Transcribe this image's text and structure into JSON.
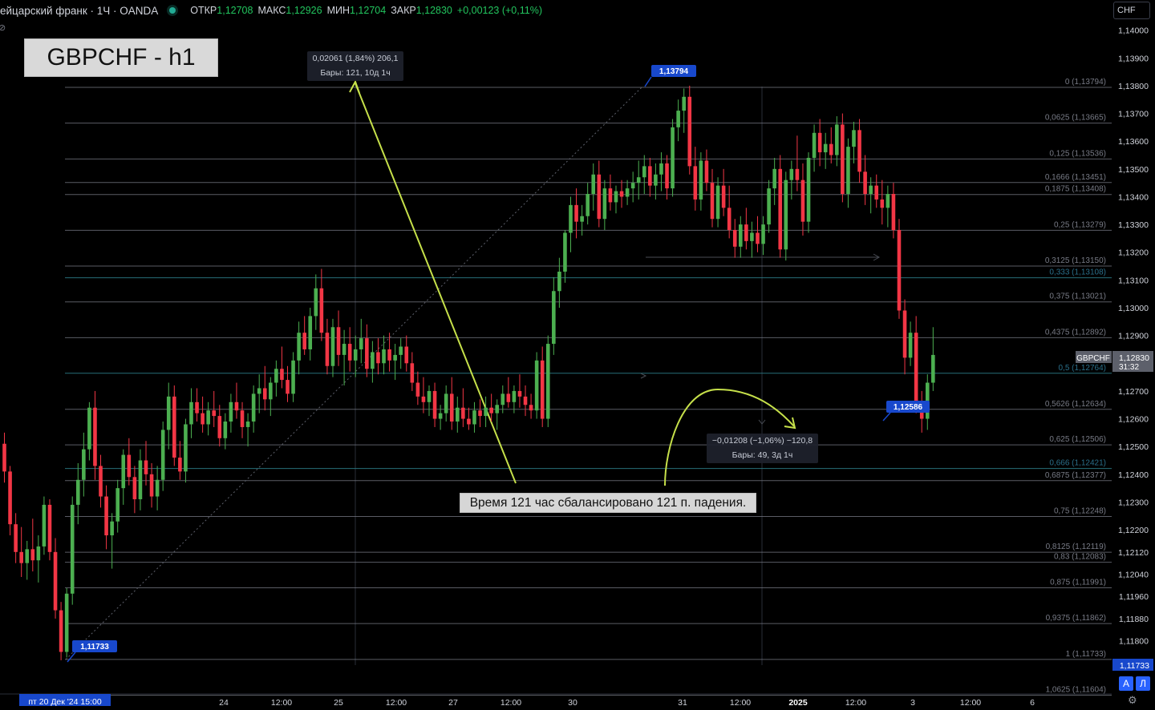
{
  "header": {
    "symbol": "ейцарский франк · 1Ч · OANDA",
    "open_label": "ОТКР",
    "open": "1,12708",
    "high_label": "МАКС",
    "high": "1,12926",
    "low_label": "МИН",
    "low": "1,12704",
    "close_label": "ЗАКР",
    "close": "1,12830",
    "change": "+0,00123 (+0,11%)"
  },
  "title_box": "GBPCHF - h1",
  "currency_button": "CHF",
  "scale_buttons": {
    "auto": "А",
    "log": "Л"
  },
  "annotation_note": "Время 121 час сбалансировано 121 п. падения.",
  "measure_up": {
    "line1": "0,02061 (1,84%) 206,1",
    "line2": "Бары: 121, 10д 1ч"
  },
  "measure_down": {
    "line1": "−0,01208 (−1,06%) −120,8",
    "line2": "Бары: 49, 3д 1ч"
  },
  "colors": {
    "background": "#000000",
    "up": "#26a69a",
    "up_candle": "#4caf50",
    "down_candle": "#f23645",
    "fib_line": "#787b86",
    "teal_line": "#2b7a85",
    "arrow": "#c6e04a",
    "label_blue": "#1848cc"
  },
  "chart_data": {
    "type": "candlestick",
    "timeframe": "1Ч",
    "y_range": [
      1.11733,
      1.1414
    ],
    "price_axis_ticks": [
      "1,14000",
      "1,13900",
      "1,13800",
      "1,13700",
      "1,13600",
      "1,13500",
      "1,13400",
      "1,13300",
      "1,13200",
      "1,13100",
      "1,13000",
      "1,12900",
      "1,12700",
      "1,12600",
      "1,12500",
      "1,12400",
      "1,12300",
      "1,12200",
      "1,12120",
      "1,12040",
      "1,11960",
      "1,11880",
      "1,11800"
    ],
    "time_axis_ticks": [
      "пт 20 Дек '24  15:00",
      "24",
      "12:00",
      "25",
      "12:00",
      "27",
      "12:00",
      "30",
      "31",
      "12:00",
      "2025",
      "12:00",
      "3",
      "12:00",
      "6"
    ],
    "fibonacci_levels": [
      {
        "ratio": "0",
        "price": "1,13794"
      },
      {
        "ratio": "0,0625",
        "price": "1,13665"
      },
      {
        "ratio": "0,125",
        "price": "1,13536"
      },
      {
        "ratio": "0,1666",
        "price": "1,13451"
      },
      {
        "ratio": "0,1875",
        "price": "1,13408"
      },
      {
        "ratio": "0,25",
        "price": "1,13279"
      },
      {
        "ratio": "0,3125",
        "price": "1,13150"
      },
      {
        "ratio": "0,333",
        "price": "1,13108"
      },
      {
        "ratio": "0,375",
        "price": "1,13021"
      },
      {
        "ratio": "0,4375",
        "price": "1,12892"
      },
      {
        "ratio": "0,5",
        "price": "1,12764"
      },
      {
        "ratio": "0,5626",
        "price": "1,12634"
      },
      {
        "ratio": "0,625",
        "price": "1,12506"
      },
      {
        "ratio": "0,666",
        "price": "1,12421"
      },
      {
        "ratio": "0,6875",
        "price": "1,12377"
      },
      {
        "ratio": "0,75",
        "price": "1,12248"
      },
      {
        "ratio": "0,8125",
        "price": "1,12119"
      },
      {
        "ratio": "0,83",
        "price": "1,12083"
      },
      {
        "ratio": "0,875",
        "price": "1,11991"
      },
      {
        "ratio": "0,9375",
        "price": "1,11862"
      },
      {
        "ratio": "1",
        "price": "1,11733"
      },
      {
        "ratio": "1,0625",
        "price": "1,11604"
      }
    ],
    "price_labels": {
      "high": "1,13794",
      "low": "1,11733",
      "last_low": "1,12586",
      "current": "1,12830",
      "current_symbol": "GBPCHF",
      "countdown": "31:32",
      "axis_low": "1,11733"
    },
    "candles": [
      [
        1.1251,
        1.1255,
        1.1237,
        1.1241
      ],
      [
        1.1241,
        1.1243,
        1.1218,
        1.1222
      ],
      [
        1.1222,
        1.1226,
        1.1208,
        1.1212
      ],
      [
        1.1212,
        1.1221,
        1.1203,
        1.1208
      ],
      [
        1.1208,
        1.1216,
        1.1202,
        1.1213
      ],
      [
        1.1213,
        1.1224,
        1.1205,
        1.1209
      ],
      [
        1.1209,
        1.1218,
        1.1201,
        1.1214
      ],
      [
        1.1214,
        1.1232,
        1.1211,
        1.1229
      ],
      [
        1.1229,
        1.1231,
        1.1209,
        1.1212
      ],
      [
        1.1212,
        1.1217,
        1.1188,
        1.1191
      ],
      [
        1.1191,
        1.1194,
        1.1173,
        1.1176
      ],
      [
        1.1176,
        1.1199,
        1.1174,
        1.1197
      ],
      [
        1.1197,
        1.1232,
        1.1193,
        1.1229
      ],
      [
        1.1229,
        1.1244,
        1.1222,
        1.1238
      ],
      [
        1.1238,
        1.1255,
        1.1232,
        1.1249
      ],
      [
        1.1249,
        1.1266,
        1.1245,
        1.1264
      ],
      [
        1.1264,
        1.127,
        1.1238,
        1.1243
      ],
      [
        1.1243,
        1.1247,
        1.1228,
        1.1232
      ],
      [
        1.1232,
        1.1236,
        1.1213,
        1.1218
      ],
      [
        1.1218,
        1.1226,
        1.1206,
        1.1223
      ],
      [
        1.1223,
        1.1238,
        1.1219,
        1.1235
      ],
      [
        1.1235,
        1.1249,
        1.1229,
        1.1247
      ],
      [
        1.1247,
        1.1253,
        1.1236,
        1.1239
      ],
      [
        1.1239,
        1.1243,
        1.1226,
        1.1231
      ],
      [
        1.1231,
        1.1249,
        1.1227,
        1.1245
      ],
      [
        1.1245,
        1.1252,
        1.1236,
        1.124
      ],
      [
        1.124,
        1.1244,
        1.1228,
        1.1232
      ],
      [
        1.1232,
        1.1243,
        1.1227,
        1.1238
      ],
      [
        1.1238,
        1.1259,
        1.1234,
        1.1256
      ],
      [
        1.1256,
        1.1273,
        1.1249,
        1.1268
      ],
      [
        1.1268,
        1.1272,
        1.1243,
        1.1246
      ],
      [
        1.1246,
        1.1252,
        1.1238,
        1.1241
      ],
      [
        1.1241,
        1.126,
        1.1237,
        1.1258
      ],
      [
        1.1258,
        1.1271,
        1.1253,
        1.1266
      ],
      [
        1.1266,
        1.1271,
        1.1259,
        1.1262
      ],
      [
        1.1262,
        1.1268,
        1.1255,
        1.1258
      ],
      [
        1.1258,
        1.1266,
        1.1254,
        1.1263
      ],
      [
        1.1263,
        1.127,
        1.1257,
        1.1261
      ],
      [
        1.1261,
        1.1265,
        1.125,
        1.1253
      ],
      [
        1.1253,
        1.1262,
        1.1249,
        1.1259
      ],
      [
        1.1259,
        1.1269,
        1.1255,
        1.1266
      ],
      [
        1.1266,
        1.1273,
        1.126,
        1.1263
      ],
      [
        1.1263,
        1.1266,
        1.1253,
        1.1257
      ],
      [
        1.1257,
        1.1262,
        1.125,
        1.1259
      ],
      [
        1.1259,
        1.1272,
        1.1255,
        1.1269
      ],
      [
        1.1269,
        1.1276,
        1.1262,
        1.1271
      ],
      [
        1.1271,
        1.1279,
        1.1263,
        1.1267
      ],
      [
        1.1267,
        1.1275,
        1.1261,
        1.1273
      ],
      [
        1.1273,
        1.1281,
        1.1268,
        1.1278
      ],
      [
        1.1278,
        1.1286,
        1.1271,
        1.1274
      ],
      [
        1.1274,
        1.1279,
        1.1266,
        1.1269
      ],
      [
        1.1269,
        1.1284,
        1.1266,
        1.1281
      ],
      [
        1.1281,
        1.1295,
        1.1276,
        1.1291
      ],
      [
        1.1291,
        1.1297,
        1.1283,
        1.1285
      ],
      [
        1.1285,
        1.13,
        1.1281,
        1.1297
      ],
      [
        1.1297,
        1.1312,
        1.1292,
        1.1307
      ],
      [
        1.1307,
        1.1314,
        1.1288,
        1.1291
      ],
      [
        1.1291,
        1.1296,
        1.1276,
        1.1279
      ],
      [
        1.1279,
        1.1296,
        1.1275,
        1.1293
      ],
      [
        1.1293,
        1.1299,
        1.1279,
        1.1283
      ],
      [
        1.1283,
        1.1292,
        1.1272,
        1.1287
      ],
      [
        1.1287,
        1.1293,
        1.1277,
        1.1281
      ],
      [
        1.1281,
        1.129,
        1.1275,
        1.1285
      ],
      [
        1.1285,
        1.1296,
        1.128,
        1.1289
      ],
      [
        1.1289,
        1.1294,
        1.1275,
        1.1278
      ],
      [
        1.1278,
        1.1288,
        1.1273,
        1.1284
      ],
      [
        1.1284,
        1.1289,
        1.1276,
        1.128
      ],
      [
        1.128,
        1.129,
        1.1276,
        1.1285
      ],
      [
        1.1285,
        1.1291,
        1.1277,
        1.1281
      ],
      [
        1.1281,
        1.1287,
        1.1274,
        1.1283
      ],
      [
        1.1283,
        1.1289,
        1.1278,
        1.1286
      ],
      [
        1.1286,
        1.129,
        1.1277,
        1.128
      ],
      [
        1.128,
        1.1284,
        1.127,
        1.1273
      ],
      [
        1.1273,
        1.1277,
        1.1265,
        1.1268
      ],
      [
        1.1268,
        1.1275,
        1.1262,
        1.1266
      ],
      [
        1.1266,
        1.1272,
        1.1261,
        1.127
      ],
      [
        1.127,
        1.1273,
        1.1257,
        1.126
      ],
      [
        1.126,
        1.1265,
        1.1256,
        1.1262
      ],
      [
        1.1262,
        1.1272,
        1.1259,
        1.1269
      ],
      [
        1.1269,
        1.1275,
        1.1256,
        1.1259
      ],
      [
        1.1259,
        1.1268,
        1.1255,
        1.1264
      ],
      [
        1.1264,
        1.1271,
        1.1257,
        1.126
      ],
      [
        1.126,
        1.1264,
        1.1256,
        1.1258
      ],
      [
        1.1258,
        1.1266,
        1.1255,
        1.1263
      ],
      [
        1.1263,
        1.1267,
        1.1257,
        1.1261
      ],
      [
        1.1261,
        1.1268,
        1.1257,
        1.1264
      ],
      [
        1.1264,
        1.1269,
        1.1259,
        1.1262
      ],
      [
        1.1262,
        1.1267,
        1.1256,
        1.1265
      ],
      [
        1.1265,
        1.1272,
        1.1262,
        1.1269
      ],
      [
        1.1269,
        1.1275,
        1.1264,
        1.1266
      ],
      [
        1.1266,
        1.1272,
        1.1262,
        1.127
      ],
      [
        1.127,
        1.1276,
        1.1264,
        1.1268
      ],
      [
        1.1268,
        1.1272,
        1.1261,
        1.1265
      ],
      [
        1.1265,
        1.1269,
        1.126,
        1.1263
      ],
      [
        1.1263,
        1.1284,
        1.126,
        1.1281
      ],
      [
        1.1281,
        1.1286,
        1.1257,
        1.126
      ],
      [
        1.126,
        1.129,
        1.1257,
        1.1287
      ],
      [
        1.1287,
        1.1311,
        1.1283,
        1.1306
      ],
      [
        1.1306,
        1.1318,
        1.13,
        1.1313
      ],
      [
        1.1313,
        1.1328,
        1.1309,
        1.1327
      ],
      [
        1.1327,
        1.134,
        1.132,
        1.1337
      ],
      [
        1.1337,
        1.1343,
        1.1325,
        1.1331
      ],
      [
        1.1331,
        1.1337,
        1.1326,
        1.1333
      ],
      [
        1.1333,
        1.1345,
        1.133,
        1.1341
      ],
      [
        1.1341,
        1.1352,
        1.1335,
        1.1348
      ],
      [
        1.1348,
        1.1353,
        1.1329,
        1.1332
      ],
      [
        1.1332,
        1.1346,
        1.1328,
        1.1343
      ],
      [
        1.1343,
        1.1348,
        1.1335,
        1.1338
      ],
      [
        1.1338,
        1.1344,
        1.1334,
        1.1342
      ],
      [
        1.1342,
        1.1346,
        1.1336,
        1.134
      ],
      [
        1.134,
        1.1346,
        1.1337,
        1.1343
      ],
      [
        1.1343,
        1.1349,
        1.1338,
        1.1345
      ],
      [
        1.1345,
        1.1353,
        1.1339,
        1.1347
      ],
      [
        1.1347,
        1.1355,
        1.1341,
        1.1351
      ],
      [
        1.1351,
        1.1354,
        1.134,
        1.1344
      ],
      [
        1.1344,
        1.1352,
        1.1339,
        1.1348
      ],
      [
        1.1348,
        1.1356,
        1.1342,
        1.1352
      ],
      [
        1.1352,
        1.1355,
        1.1339,
        1.1343
      ],
      [
        1.1343,
        1.1368,
        1.134,
        1.1365
      ],
      [
        1.1365,
        1.1375,
        1.136,
        1.1371
      ],
      [
        1.1371,
        1.1379,
        1.1363,
        1.1376
      ],
      [
        1.1376,
        1.138,
        1.1348,
        1.1351
      ],
      [
        1.1351,
        1.1358,
        1.1335,
        1.1339
      ],
      [
        1.1339,
        1.1356,
        1.1335,
        1.1353
      ],
      [
        1.1353,
        1.1357,
        1.1342,
        1.1345
      ],
      [
        1.1345,
        1.135,
        1.1329,
        1.1332
      ],
      [
        1.1332,
        1.1347,
        1.1329,
        1.1344
      ],
      [
        1.1344,
        1.135,
        1.1333,
        1.1336
      ],
      [
        1.1336,
        1.1344,
        1.1325,
        1.1328
      ],
      [
        1.1328,
        1.1332,
        1.1318,
        1.1322
      ],
      [
        1.1322,
        1.1333,
        1.1318,
        1.133
      ],
      [
        1.133,
        1.1336,
        1.1321,
        1.1324
      ],
      [
        1.1324,
        1.1331,
        1.1318,
        1.1327
      ],
      [
        1.1327,
        1.1333,
        1.132,
        1.1323
      ],
      [
        1.1323,
        1.1333,
        1.1319,
        1.133
      ],
      [
        1.133,
        1.1346,
        1.1327,
        1.1343
      ],
      [
        1.1343,
        1.1354,
        1.1337,
        1.135
      ],
      [
        1.135,
        1.1355,
        1.1318,
        1.1321
      ],
      [
        1.1321,
        1.1349,
        1.1317,
        1.1346
      ],
      [
        1.1346,
        1.1353,
        1.1339,
        1.135
      ],
      [
        1.135,
        1.1362,
        1.1342,
        1.1346
      ],
      [
        1.1346,
        1.1352,
        1.1326,
        1.1331
      ],
      [
        1.1331,
        1.1356,
        1.1327,
        1.1354
      ],
      [
        1.1354,
        1.1366,
        1.1349,
        1.1363
      ],
      [
        1.1363,
        1.1368,
        1.1351,
        1.1356
      ],
      [
        1.1356,
        1.1363,
        1.135,
        1.1359
      ],
      [
        1.1359,
        1.1365,
        1.1352,
        1.1355
      ],
      [
        1.1355,
        1.1369,
        1.1351,
        1.1366
      ],
      [
        1.1366,
        1.137,
        1.1338,
        1.1341
      ],
      [
        1.1341,
        1.1361,
        1.1336,
        1.1358
      ],
      [
        1.1358,
        1.1367,
        1.1352,
        1.1364
      ],
      [
        1.1364,
        1.1368,
        1.1345,
        1.1349
      ],
      [
        1.1349,
        1.1355,
        1.1337,
        1.1341
      ],
      [
        1.1341,
        1.1347,
        1.1334,
        1.1344
      ],
      [
        1.1344,
        1.1348,
        1.1336,
        1.1339
      ],
      [
        1.1339,
        1.1346,
        1.133,
        1.1336
      ],
      [
        1.1336,
        1.1344,
        1.1329,
        1.1341
      ],
      [
        1.1341,
        1.1345,
        1.1325,
        1.1328
      ],
      [
        1.1328,
        1.1332,
        1.1296,
        1.1299
      ],
      [
        1.1299,
        1.1303,
        1.1276,
        1.1282
      ],
      [
        1.1282,
        1.1295,
        1.1279,
        1.1291
      ],
      [
        1.1291,
        1.1297,
        1.1262,
        1.1265
      ],
      [
        1.1265,
        1.127,
        1.1255,
        1.126
      ],
      [
        1.126,
        1.1276,
        1.1256,
        1.1273
      ],
      [
        1.1273,
        1.1293,
        1.127,
        1.1283
      ]
    ]
  }
}
